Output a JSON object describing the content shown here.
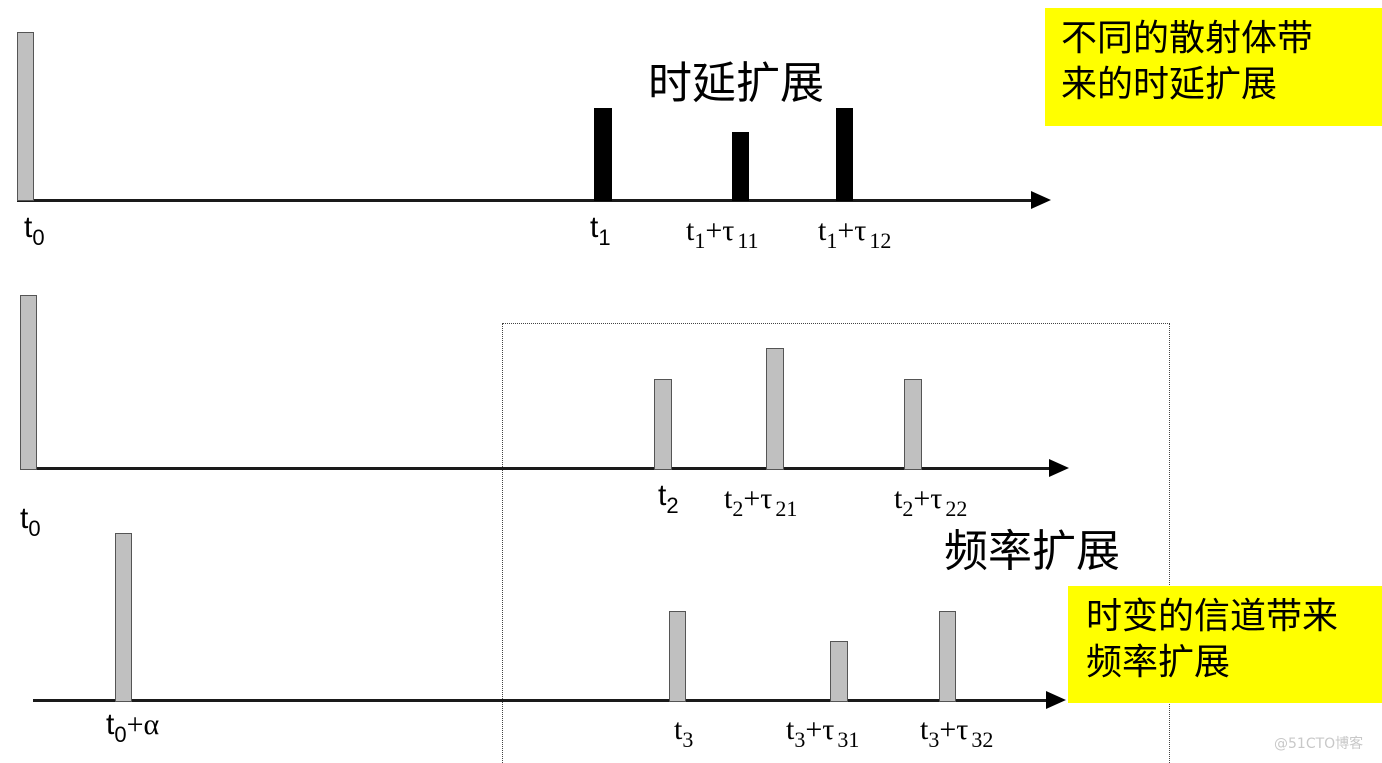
{
  "title_delay_spread": "时延扩展",
  "title_freq_spread": "频率扩展",
  "note_top": {
    "lines": [
      "不同的散射体带",
      "来的时延扩展"
    ],
    "background": "#ffff00"
  },
  "note_bottom": {
    "lines": [
      "时变的信道带来",
      "频率扩展"
    ],
    "background": "#ffff00"
  },
  "watermark": "@51CTO博客",
  "rows": [
    {
      "name": "row-1",
      "bars": [
        {
          "label_main": "t",
          "label_sub": "0",
          "label_suffix": "",
          "label_suffix_sub": "",
          "amplitude": 1.0,
          "style": "gray"
        },
        {
          "label_main": "t",
          "label_sub": "1",
          "label_suffix": "",
          "label_suffix_sub": "",
          "amplitude": 0.55,
          "style": "black"
        },
        {
          "label_main": "t",
          "label_sub": "1",
          "label_suffix": "+τ",
          "label_suffix_sub": "11",
          "amplitude": 0.41,
          "style": "black"
        },
        {
          "label_main": "t",
          "label_sub": "1",
          "label_suffix": "+τ",
          "label_suffix_sub": "12",
          "amplitude": 0.55,
          "style": "black"
        }
      ]
    },
    {
      "name": "row-2",
      "bars": [
        {
          "label_main": "t",
          "label_sub": "0",
          "label_suffix": "",
          "label_suffix_sub": "",
          "amplitude": 1.0,
          "style": "gray"
        },
        {
          "label_main": "t",
          "label_sub": "2",
          "label_suffix": "",
          "label_suffix_sub": "",
          "amplitude": 0.52,
          "style": "gray"
        },
        {
          "label_main": "t",
          "label_sub": "2",
          "label_suffix": "+τ",
          "label_suffix_sub": "21",
          "amplitude": 0.7,
          "style": "gray"
        },
        {
          "label_main": "t",
          "label_sub": "2",
          "label_suffix": "+τ",
          "label_suffix_sub": "22",
          "amplitude": 0.52,
          "style": "gray"
        }
      ]
    },
    {
      "name": "row-3",
      "bars": [
        {
          "label_main": "t",
          "label_sub": "0",
          "label_suffix": "+α",
          "label_suffix_sub": "",
          "amplitude": 1.0,
          "style": "gray"
        },
        {
          "label_main": "t",
          "label_sub": "3",
          "label_suffix": "",
          "label_suffix_sub": "",
          "amplitude": 0.54,
          "style": "gray"
        },
        {
          "label_main": "t",
          "label_sub": "3",
          "label_suffix": "+τ",
          "label_suffix_sub": "31",
          "amplitude": 0.36,
          "style": "gray"
        },
        {
          "label_main": "t",
          "label_sub": "3",
          "label_suffix": "+τ",
          "label_suffix_sub": "32",
          "amplitude": 0.54,
          "style": "gray"
        }
      ]
    }
  ]
}
